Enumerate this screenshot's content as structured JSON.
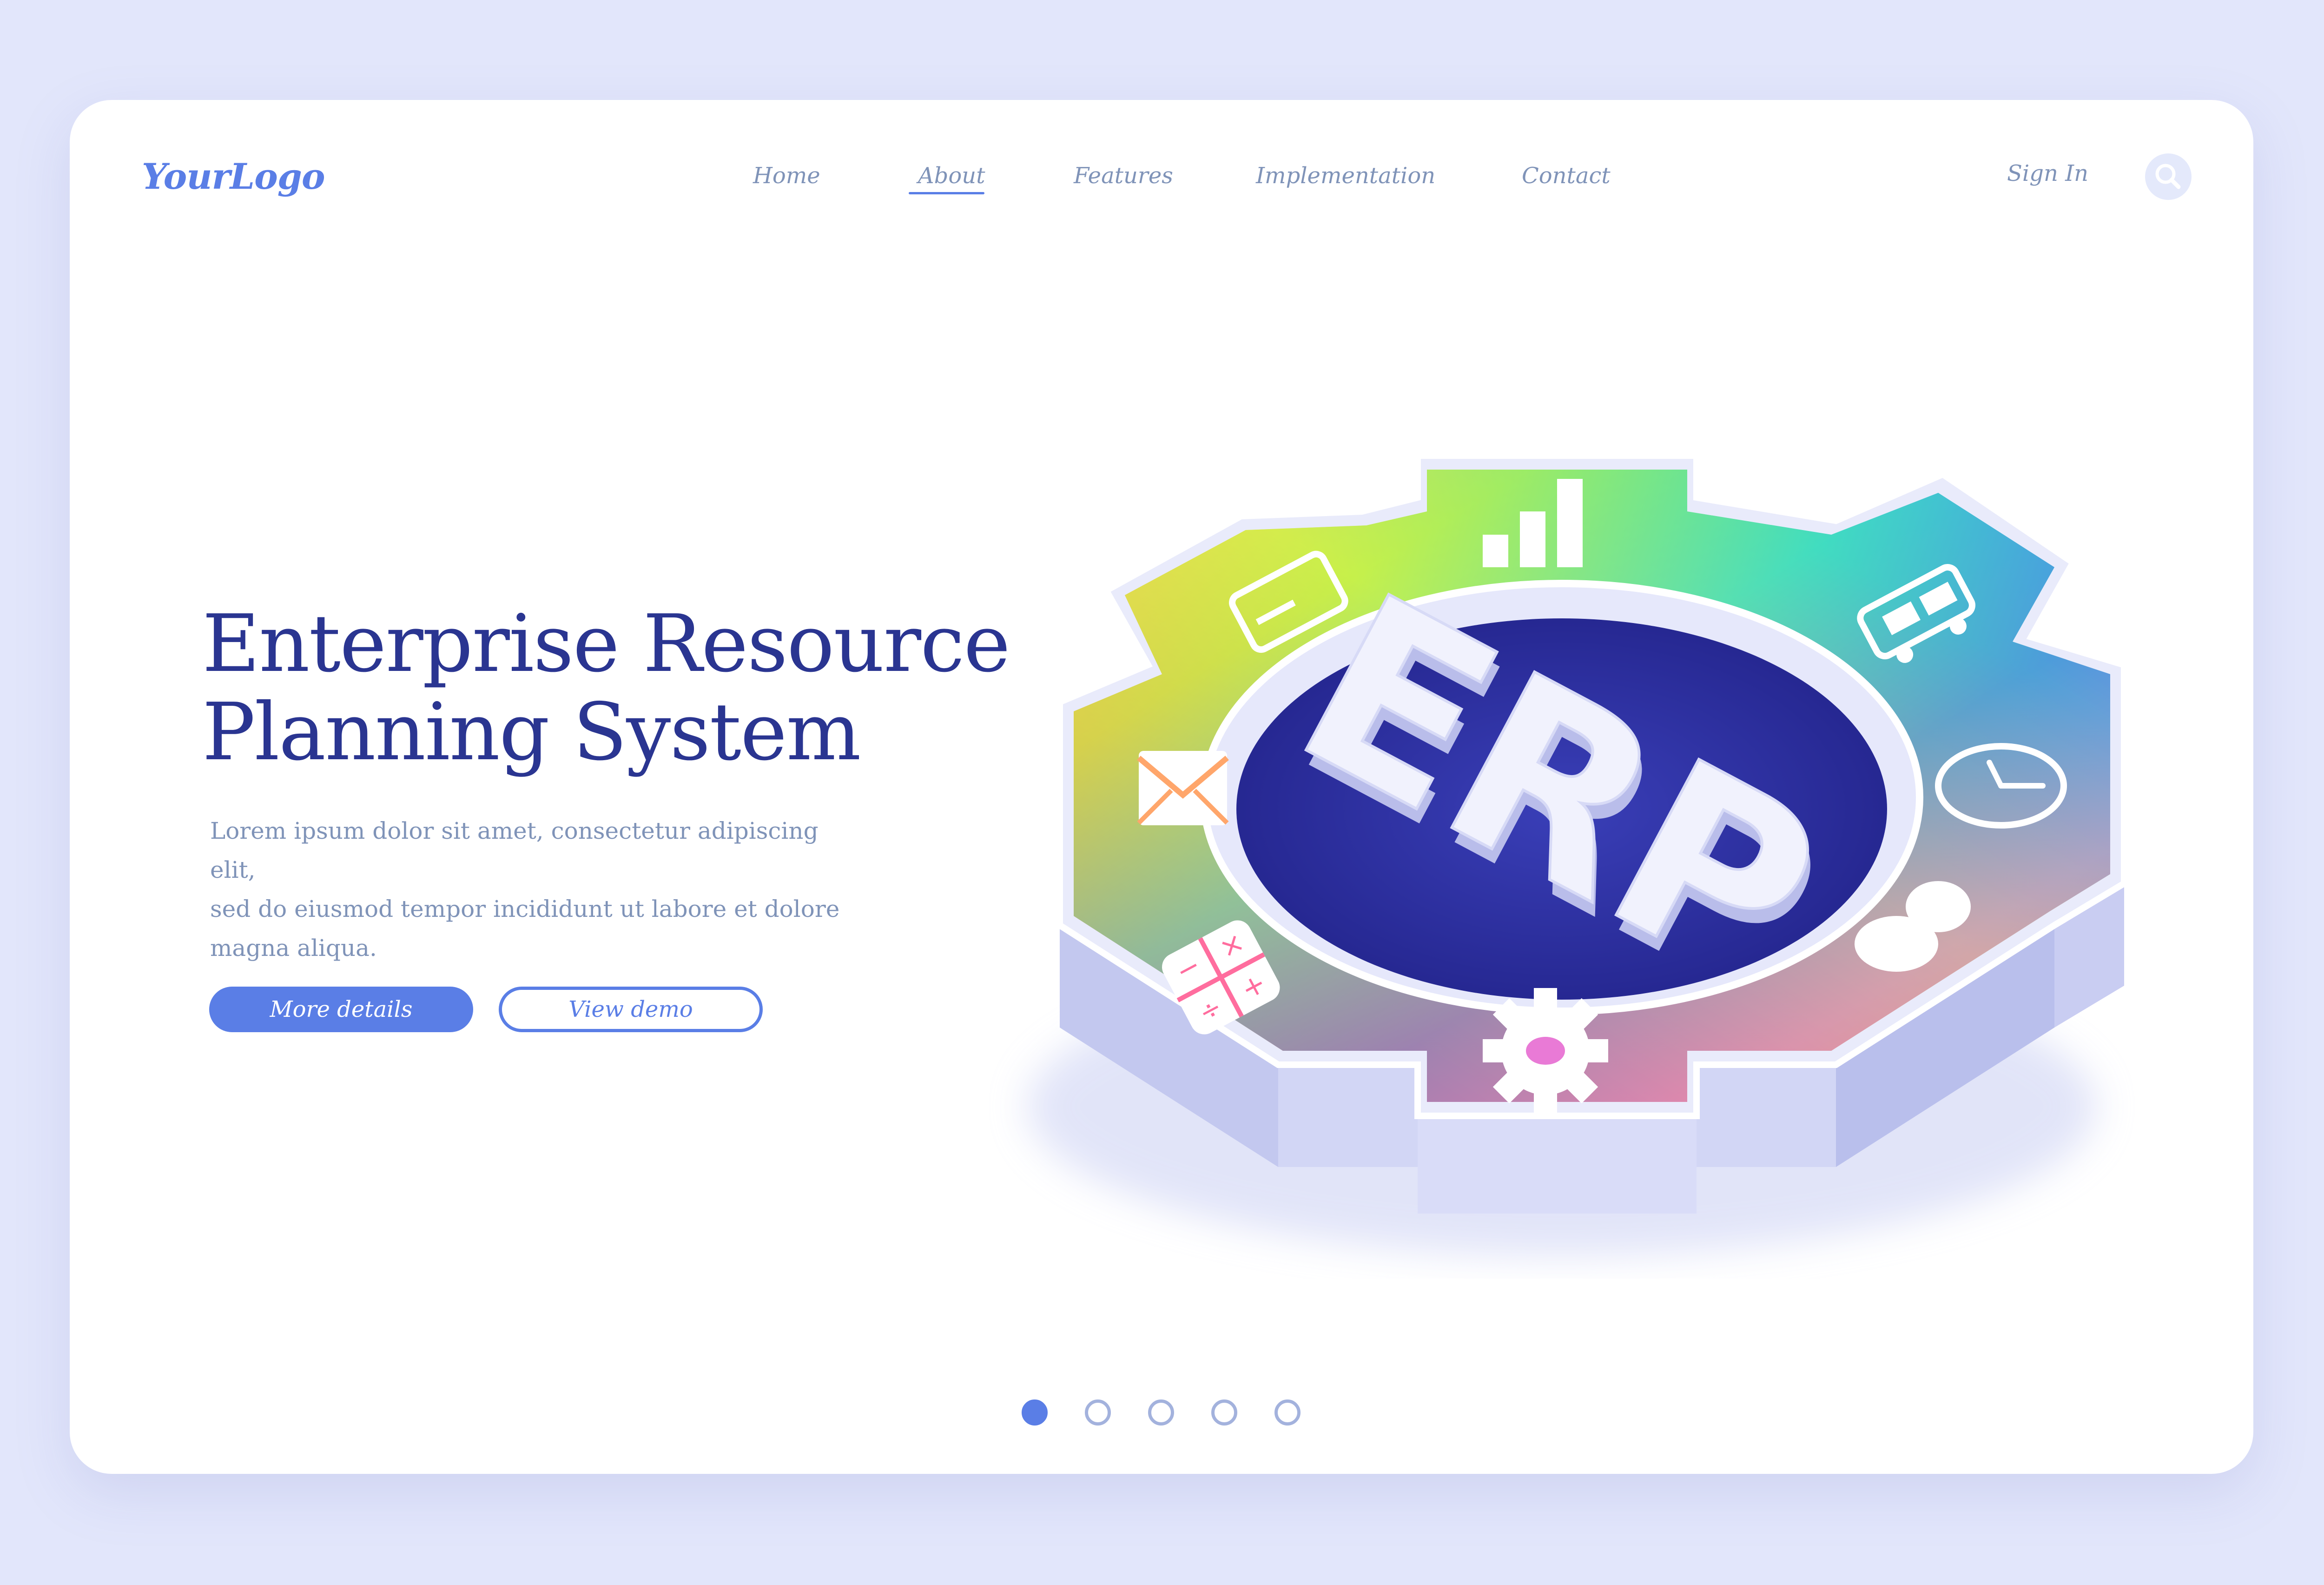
{
  "header": {
    "logo": "YourLogo",
    "nav": [
      "Home",
      "About",
      "Features",
      "Implementation",
      "Contact"
    ],
    "active_nav": "About",
    "sign_in": "Sign In",
    "search_icon": "search-icon"
  },
  "hero": {
    "title_line1": "Enterprise Resource",
    "title_line2": "Planning System",
    "description_line1": "Lorem ipsum dolor sit amet, consectetur adipiscing elit,",
    "description_line2": "sed do eiusmod tempor incididunt ut labore et dolore",
    "description_line3": "magna aliqua.",
    "primary_button": "More details",
    "secondary_button": "View demo"
  },
  "illustration": {
    "center_text": "ERP",
    "icons": [
      "bar-chart-icon",
      "credit-card-icon",
      "envelope-icon",
      "calculator-icon",
      "gear-icon",
      "user-icon",
      "clock-icon",
      "truck-icon"
    ]
  },
  "pagination": {
    "count": 5,
    "active": 1
  },
  "colors": {
    "accent": "#5a7ee6",
    "title": "#2a3591",
    "text": "#7f93b8",
    "background": "#e2e6fb"
  }
}
